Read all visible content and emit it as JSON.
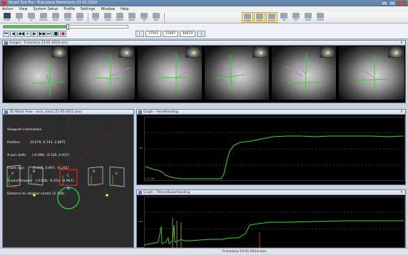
{
  "window": {
    "title": "Smart Eye Pro - Francesco Mammone 23-01-2014"
  },
  "menu": [
    "Action",
    "View",
    "System Setup",
    "Profile",
    "Settings",
    "Window",
    "Help"
  ],
  "toolbar": {
    "left_buttons": [
      "track",
      "s1",
      "s2",
      "record",
      "play",
      "load",
      "save"
    ],
    "mid_buttons": [
      "sfm",
      "calib",
      "define",
      "gaze",
      "3D",
      "pan"
    ],
    "right_buttons": [
      "image",
      "views",
      "graph",
      "3d",
      "rec",
      "zone",
      "zones"
    ]
  },
  "playback": {
    "progress_fraction": 0.52,
    "fields": [
      "17505",
      "25487",
      "46670"
    ]
  },
  "images_panel": {
    "title": "Images - Francesco 23-01-2014.sma"
  },
  "world_panel": {
    "title": "3D World View - ossa_vision 21-05-2012.sesv",
    "info_lines": [
      "Viewport Information",
      "Position          [0.679, 0.743, 2.867]",
      "X-axis (left)      [-0.999, -0.030, 0.037]",
      "Y-axis (up)        [0.036, 0.967, -0.252]",
      "Z-axis(forward)   [-0.028, -0.253, -0.967]",
      "Distance to rotation center [2.798]"
    ],
    "screen_labels": [
      "A",
      "B",
      "C",
      "D",
      "E"
    ]
  },
  "graph_heading": {
    "title": "Graph - HeadHeading",
    "y_label": "rad",
    "x_note": "x 7.08s"
  },
  "graph_gaze": {
    "title": "Graph - FilteredGazeHeading",
    "y_label": "rad"
  },
  "statusbar": {
    "text": "Francesco 23-01-2014.sma"
  },
  "colors": {
    "accent": "#5a7ea8",
    "signal": "#3ad63a",
    "alert": "#d32020"
  }
}
